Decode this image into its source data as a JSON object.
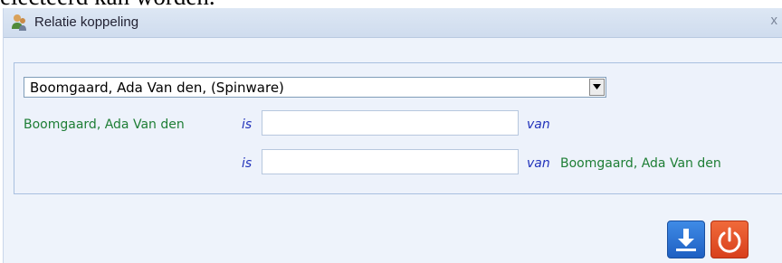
{
  "background_text": "electeerd kan worden.",
  "dialog": {
    "title": "Relatie koppeling",
    "close_symbol": "x",
    "title_icon": "users-icon"
  },
  "form": {
    "person_select": {
      "selected": "Boomgaard, Ada Van den, (Spinware)"
    },
    "row1": {
      "name": "Boomgaard, Ada Van den",
      "is": "is",
      "van": "van",
      "value": ""
    },
    "row2": {
      "is": "is",
      "van": "van",
      "name": "Boomgaard, Ada Van den",
      "value": ""
    }
  },
  "buttons": {
    "save_icon": "download-icon",
    "power_icon": "power-icon"
  },
  "colors": {
    "accent_green": "#1e7e35",
    "accent_blue": "#2233bb",
    "save_blue": "#2a73d8",
    "power_red": "#e5532a"
  }
}
